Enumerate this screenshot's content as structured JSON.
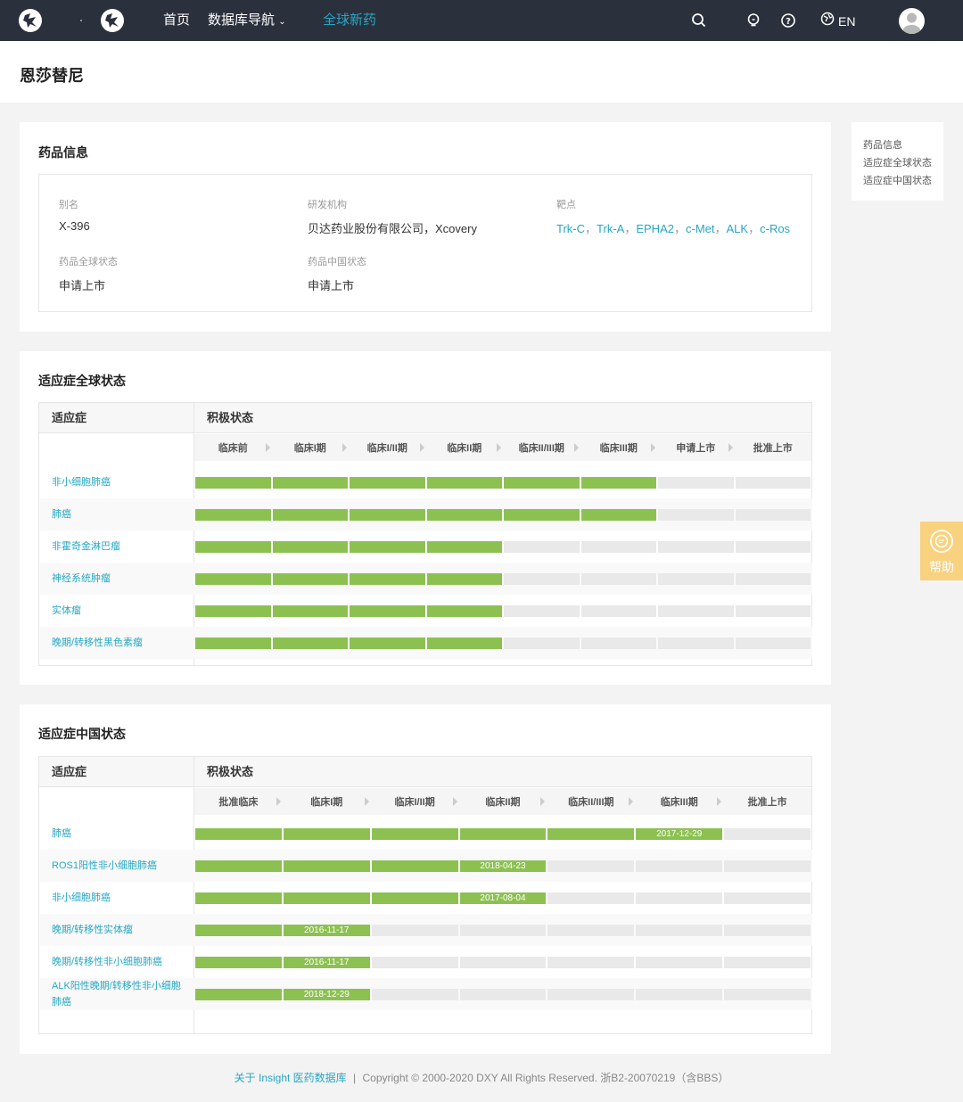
{
  "nav": {
    "links": [
      "首页",
      "数据库导航",
      "全球新药"
    ],
    "lang": "EN",
    "icons": [
      "search-icon",
      "bulb-icon",
      "question-icon",
      "language-icon",
      "avatar-icon"
    ]
  },
  "page": {
    "title": "恩莎替尼"
  },
  "sidenav": {
    "items": [
      "药品信息",
      "适应症全球状态",
      "适应症中国状态"
    ]
  },
  "help": {
    "label": "帮助"
  },
  "drug_info": {
    "title": "药品信息",
    "alias_label": "别名",
    "alias": "X-396",
    "org_label": "研发机构",
    "org": "贝达药业股份有限公司，Xcovery",
    "target_label": "靶点",
    "targets": [
      "Trk-C",
      "Trk-A",
      "EPHA2",
      "c-Met",
      "ALK",
      "c-Ros"
    ],
    "global_status_label": "药品全球状态",
    "global_status": "申请上市",
    "china_status_label": "药品中国状态",
    "china_status": "申请上市"
  },
  "global_status": {
    "title": "适应症全球状态",
    "col_indication": "适应症",
    "col_status": "积极状态",
    "stages": [
      "临床前",
      "临床I期",
      "临床I/II期",
      "临床II期",
      "临床II/III期",
      "临床III期",
      "申请上市",
      "批准上市"
    ],
    "rows": [
      {
        "indication": "非小细胞肺癌",
        "progress": 6,
        "date": ""
      },
      {
        "indication": "肺癌",
        "progress": 6,
        "date": ""
      },
      {
        "indication": "非霍奇金淋巴瘤",
        "progress": 4,
        "date": ""
      },
      {
        "indication": "神经系统肿瘤",
        "progress": 4,
        "date": ""
      },
      {
        "indication": "实体瘤",
        "progress": 4,
        "date": ""
      },
      {
        "indication": "晚期/转移性黑色素瘤",
        "progress": 4,
        "date": ""
      }
    ]
  },
  "china_status": {
    "title": "适应症中国状态",
    "col_indication": "适应症",
    "col_status": "积极状态",
    "stages": [
      "批准临床",
      "临床I期",
      "临床I/II期",
      "临床II期",
      "临床II/III期",
      "临床III期",
      "批准上市"
    ],
    "rows": [
      {
        "indication": "肺癌",
        "progress": 6,
        "date": "2017-12-29"
      },
      {
        "indication": "ROS1阳性非小细胞肺癌",
        "progress": 4,
        "date": "2018-04-23"
      },
      {
        "indication": "非小细胞肺癌",
        "progress": 4,
        "date": "2017-08-04"
      },
      {
        "indication": "晚期/转移性实体瘤",
        "progress": 2,
        "date": "2016-11-17"
      },
      {
        "indication": "晚期/转移性非小细胞肺癌",
        "progress": 2,
        "date": "2016-11-17"
      },
      {
        "indication": "ALK阳性晚期/转移性非小细胞肺癌",
        "progress": 2,
        "date": "2018-12-29"
      }
    ]
  },
  "footer": {
    "link": "关于 Insight 医药数据库",
    "sep": "|",
    "text": "Copyright © 2000-2020 DXY All Rights Reserved. 浙B2-20070219（含BBS）"
  },
  "colors": {
    "nav_bg": "#2b303d",
    "accent": "#27a7c4",
    "bar": "#8cc152",
    "bar_empty": "#e9e9e9",
    "help": "#f8d27e"
  }
}
